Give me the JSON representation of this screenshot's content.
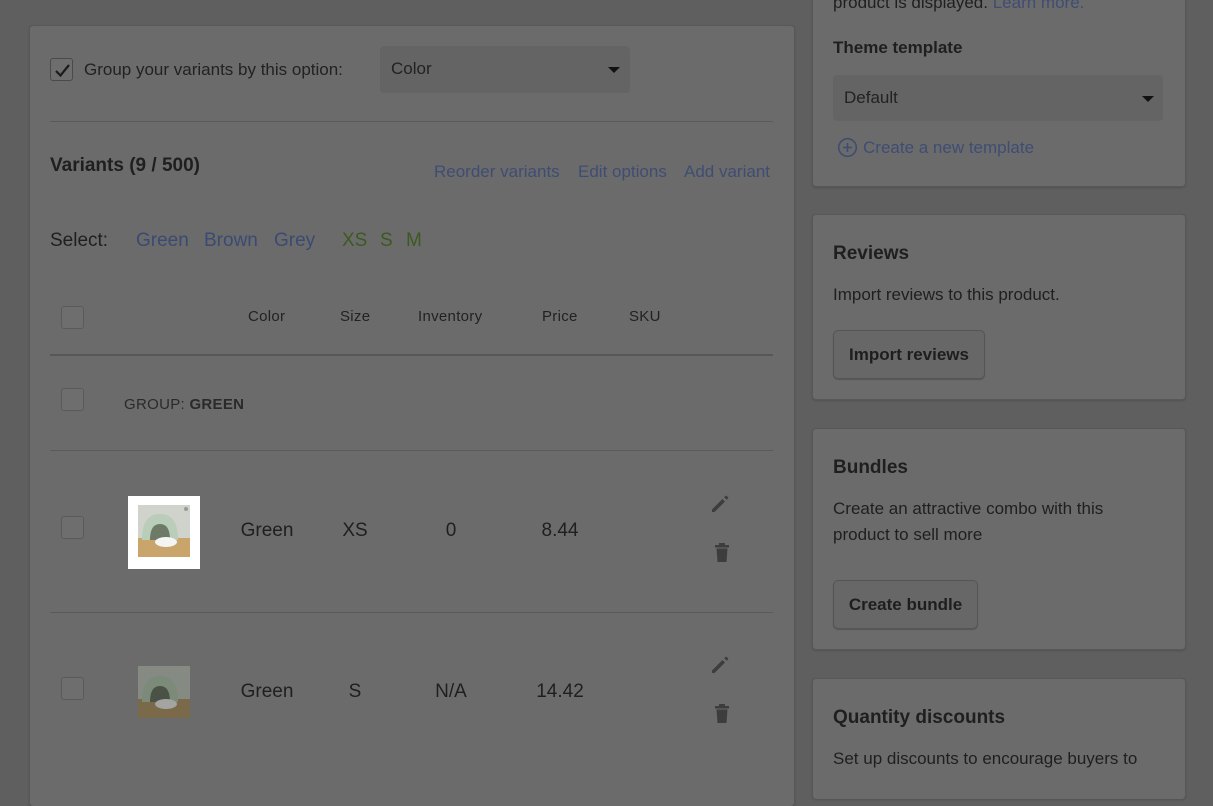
{
  "main": {
    "group_option": {
      "checked": true,
      "label": "Group your variants by this option:",
      "selected": "Color"
    },
    "variants": {
      "title": "Variants (9 / 500)",
      "actions": [
        "Reorder variants",
        "Edit options",
        "Add variant"
      ]
    },
    "select": {
      "label": "Select:",
      "colors": [
        "Green",
        "Brown",
        "Grey"
      ],
      "sizes": [
        "XS",
        "S",
        "M"
      ]
    },
    "table": {
      "headers": [
        "Color",
        "Size",
        "Inventory",
        "Price",
        "SKU"
      ],
      "group": {
        "prefix": "GROUP:",
        "name": "GREEN"
      },
      "rows": [
        {
          "color": "Green",
          "size": "XS",
          "inventory": "0",
          "price": "8.44",
          "sku": ""
        },
        {
          "color": "Green",
          "size": "S",
          "inventory": "N/A",
          "price": "14.42",
          "sku": ""
        }
      ]
    }
  },
  "sidebar": {
    "top_partial_text": "product is displayed.",
    "learn_more": "Learn more.",
    "theme_template": {
      "title": "Theme template",
      "selected": "Default",
      "create_link": "Create a new template"
    },
    "reviews": {
      "title": "Reviews",
      "text": "Import reviews to this product.",
      "button": "Import reviews"
    },
    "bundles": {
      "title": "Bundles",
      "text": "Create an attractive combo with this product to sell more",
      "button": "Create bundle"
    },
    "quantity_discounts": {
      "title": "Quantity discounts",
      "text": "Set up discounts to encourage buyers to"
    }
  },
  "colors": {
    "overlay": "#5f5f5f",
    "link": "#3f4d73",
    "size_filter": "#3c5a1f"
  }
}
